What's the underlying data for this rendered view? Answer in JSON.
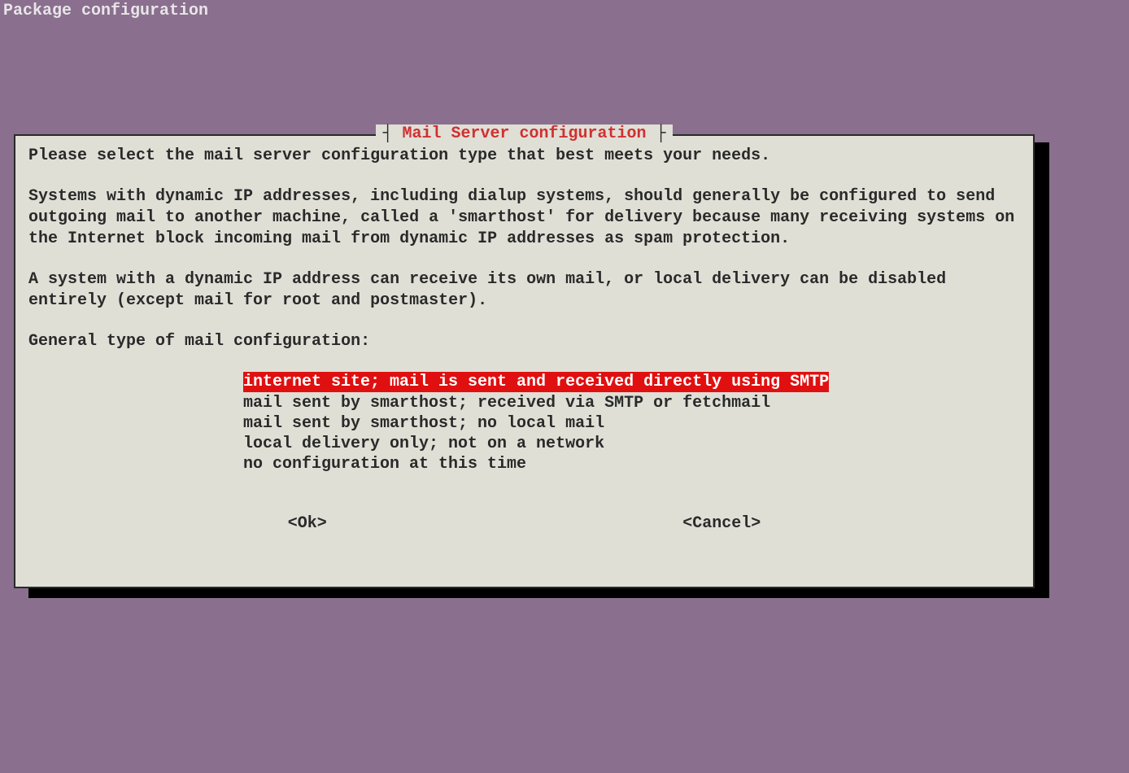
{
  "header": {
    "title": "Package configuration"
  },
  "dialog": {
    "title": "Mail Server configuration",
    "para1": "Please select the mail server configuration type that best meets your needs.",
    "para2": "Systems with dynamic IP addresses, including dialup systems, should generally be configured to send outgoing mail to another machine, called a 'smarthost' for delivery because many receiving systems on the Internet block incoming mail from dynamic IP addresses as spam protection.",
    "para3": "A system with a dynamic IP address can receive its own mail, or local delivery can be disabled entirely (except mail for root and postmaster).",
    "prompt": "General type of mail configuration:",
    "options": [
      "internet site; mail is sent and received directly using SMTP",
      "mail sent by smarthost; received via SMTP or fetchmail",
      "mail sent by smarthost; no local mail",
      "local delivery only; not on a network",
      "no configuration at this time"
    ],
    "selectedIndex": 0,
    "buttons": {
      "ok": "<Ok>",
      "cancel": "<Cancel>"
    }
  }
}
